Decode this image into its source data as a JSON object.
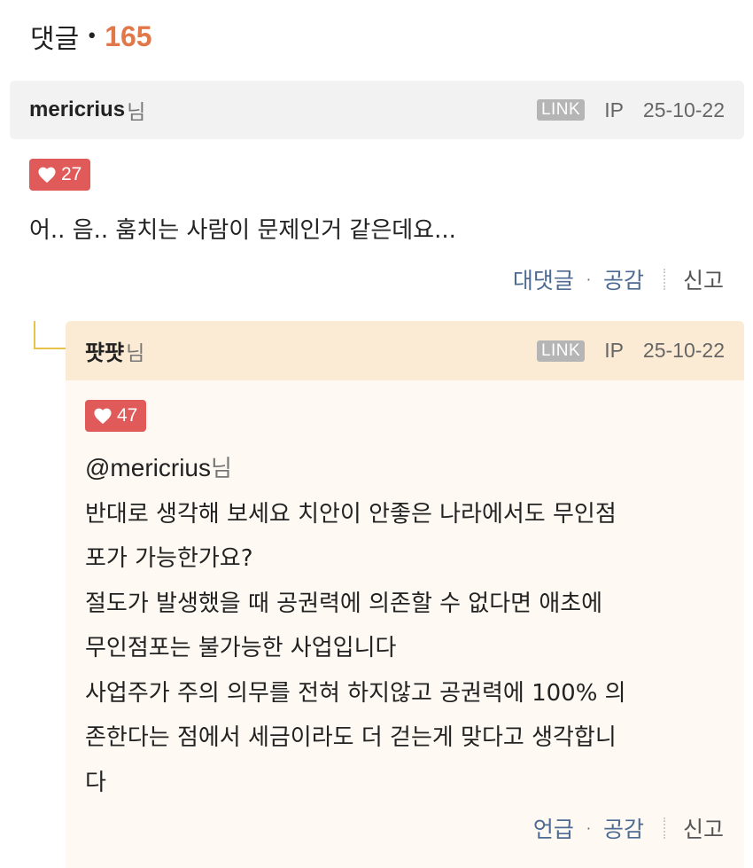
{
  "header": {
    "label": "댓글",
    "separator": "•",
    "count": "165"
  },
  "comments": [
    {
      "author": "mericrius",
      "author_suffix": "님",
      "link_badge": "LINK",
      "ip_label": "IP",
      "date": "25-10-22",
      "likes": "27",
      "text": "어.. 음.. 훔치는 사람이 문제인거 같은데요...",
      "actions": {
        "reply_label": "대댓글",
        "dot": "·",
        "like_label": "공감",
        "report_label": "신고"
      }
    }
  ],
  "reply": {
    "author": "퍗퍗",
    "author_suffix": "님",
    "link_badge": "LINK",
    "ip_label": "IP",
    "date": "25-10-22",
    "likes": "47",
    "mention": "@mericrius",
    "mention_suffix": "님",
    "lines": [
      "반대로 생각해 보세요 치안이 안좋은 나라에서도 무인점",
      "포가 가능한가요?",
      "절도가 발생했을 때 공권력에 의존할 수 없다면 애초에",
      "무인점포는 불가능한 사업입니다",
      "사업주가 주의 의무를 전혀 하지않고 공권력에 100% 의",
      "존한다는 점에서 세금이라도 더 걷는게 맞다고 생각합니",
      "다"
    ],
    "actions": {
      "mention_label": "언급",
      "dot": "·",
      "like_label": "공감",
      "report_label": "신고"
    }
  },
  "colors": {
    "count_accent": "#e0784a",
    "like_badge": "#e05a5a",
    "action_link": "#4d6b92",
    "reply_header_bg": "#fcebd4",
    "reply_body_bg": "#fefaf3",
    "comment_header_bg": "#f2f2f2",
    "connector": "#e8c24a"
  }
}
